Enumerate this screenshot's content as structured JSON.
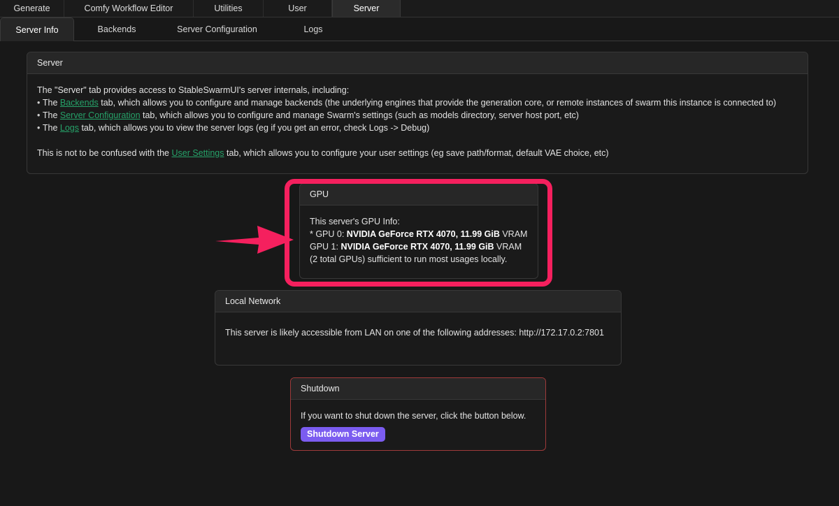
{
  "topnav": {
    "tabs": [
      {
        "label": "Generate",
        "active": false
      },
      {
        "label": "Comfy Workflow Editor",
        "active": false
      },
      {
        "label": "Utilities",
        "active": false
      },
      {
        "label": "User",
        "active": false
      },
      {
        "label": "Server",
        "active": true
      }
    ]
  },
  "subnav": {
    "tabs": [
      {
        "label": "Server Info",
        "active": true
      },
      {
        "label": "Backends",
        "active": false
      },
      {
        "label": "Server Configuration",
        "active": false
      },
      {
        "label": "Logs",
        "active": false
      }
    ]
  },
  "server_panel": {
    "title": "Server",
    "intro": "The \"Server\" tab provides access to StableSwarmUI's server internals, including:",
    "bullets": [
      {
        "prefix": "The ",
        "link": "Backends",
        "suffix": " tab, which allows you to configure and manage backends (the underlying engines that provide the generation core, or remote instances of swarm this instance is connected to)"
      },
      {
        "prefix": "The ",
        "link": "Server Configuration",
        "suffix": " tab, which allows you to configure and manage Swarm's settings (such as models directory, server host port, etc)"
      },
      {
        "prefix": "The ",
        "link": "Logs",
        "suffix": " tab, which allows you to view the server logs (eg if you get an error, check Logs -> Debug)"
      }
    ],
    "footer": {
      "prefix": "This is not to be confused with the ",
      "link": "User Settings",
      "suffix": " tab, which allows you to configure your user settings (eg save path/format, default VAE choice, etc)"
    }
  },
  "gpu_panel": {
    "title": "GPU",
    "intro": "This server's GPU Info:",
    "gpus": [
      {
        "prefix": "* GPU 0: ",
        "name": "NVIDIA GeForce RTX 4070, 11.99 GiB",
        "suffix": " VRAM"
      },
      {
        "prefix": "GPU 1: ",
        "name": "NVIDIA GeForce RTX 4070, 11.99 GiB",
        "suffix": " VRAM"
      }
    ],
    "summary": "(2 total GPUs) sufficient to run most usages locally."
  },
  "lan_panel": {
    "title": "Local Network",
    "text": "This server is likely accessible from LAN on one of the following addresses: http://172.17.0.2:7801"
  },
  "shutdown_panel": {
    "title": "Shutdown",
    "text": "If you want to shut down the server, click the button below.",
    "button_label": "Shutdown Server"
  },
  "annotations": {
    "highlight_color": "#f5205e",
    "arrow_color": "#f5205e"
  },
  "colors": {
    "link": "#26a269",
    "accent_purple": "#7b5cf0",
    "shutdown_border": "#9e3a3a",
    "background": "#181818"
  }
}
